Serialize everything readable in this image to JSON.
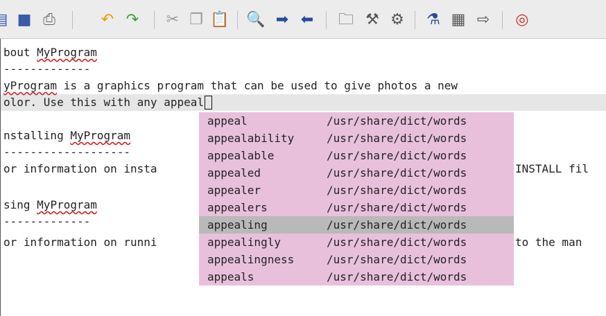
{
  "toolbar": {
    "icons": [
      {
        "name": "open-icon",
        "glyph": "▤",
        "color": "#3b5ba8"
      },
      {
        "name": "save-icon",
        "glyph": "■",
        "color": "#3b5ba8"
      },
      {
        "name": "print-icon",
        "glyph": "⎙",
        "color": "#666666"
      },
      {
        "name": "undo-icon",
        "glyph": "↶",
        "color": "#e8a000"
      },
      {
        "name": "redo-icon",
        "glyph": "↷",
        "color": "#38a038"
      },
      {
        "name": "cut-icon",
        "glyph": "✂",
        "color": "#9a9a9a"
      },
      {
        "name": "copy-icon",
        "glyph": "❐",
        "color": "#9a9a9a"
      },
      {
        "name": "paste-icon",
        "glyph": "📋",
        "color": "#555555"
      },
      {
        "name": "find-icon",
        "glyph": "🔍",
        "color": "#3b5ba8"
      },
      {
        "name": "next-icon",
        "glyph": "➡",
        "color": "#2a4a9a"
      },
      {
        "name": "previous-icon",
        "glyph": "⬅",
        "color": "#2a4a9a"
      },
      {
        "name": "folder-icon",
        "glyph": "🗀",
        "color": "#555555"
      },
      {
        "name": "build-icon",
        "glyph": "⚒",
        "color": "#555555"
      },
      {
        "name": "settings-icon",
        "glyph": "⚙",
        "color": "#555555"
      },
      {
        "name": "tool-icon",
        "glyph": "⚗",
        "color": "#2a4a9a"
      },
      {
        "name": "table-icon",
        "glyph": "▦",
        "color": "#555555"
      },
      {
        "name": "run-icon",
        "glyph": "⇨",
        "color": "#555555"
      },
      {
        "name": "help-icon",
        "glyph": "◎",
        "color": "#d03020"
      }
    ]
  },
  "editor": {
    "lines": [
      {
        "prefix": "",
        "squiggle": "",
        "text": "bout ",
        "squiggle_after": "MyProgram",
        "rest": ""
      },
      {
        "text": "-------------"
      },
      {
        "prefix": "",
        "squiggle": "yProgram",
        "text": " is a graphics program that can be used to give photos a new"
      },
      {
        "text": "olor. Use this with any appeal"
      },
      {
        "text": ""
      },
      {
        "prefix": "",
        "squiggle": "",
        "text": "nstalling ",
        "squiggle_after": "MyProgram"
      },
      {
        "text": "-------------------"
      },
      {
        "text": "or information on insta",
        "rest": "INSTALL fil"
      },
      {
        "text": ""
      },
      {
        "prefix": "",
        "squiggle": "",
        "text": "sing ",
        "squiggle_after": "MyProgram"
      },
      {
        "text": "-------------"
      },
      {
        "text": "or information on runni",
        "rest": "to the man"
      }
    ]
  },
  "autocomplete": {
    "selected_index": 6,
    "items": [
      {
        "word": "appeal",
        "source": "/usr/share/dict/words"
      },
      {
        "word": "appealability",
        "source": "/usr/share/dict/words"
      },
      {
        "word": "appealable",
        "source": "/usr/share/dict/words"
      },
      {
        "word": "appealed",
        "source": "/usr/share/dict/words"
      },
      {
        "word": "appealer",
        "source": "/usr/share/dict/words"
      },
      {
        "word": "appealers",
        "source": "/usr/share/dict/words"
      },
      {
        "word": "appealing",
        "source": "/usr/share/dict/words"
      },
      {
        "word": "appealingly",
        "source": "/usr/share/dict/words"
      },
      {
        "word": "appealingness",
        "source": "/usr/share/dict/words"
      },
      {
        "word": "appeals",
        "source": "/usr/share/dict/words"
      }
    ]
  }
}
